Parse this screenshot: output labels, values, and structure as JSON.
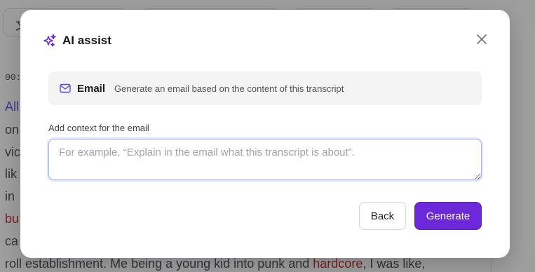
{
  "background": {
    "toolbar_glyph": "文",
    "timestamp": "00:",
    "lines": [
      {
        "text": "All"
      },
      {
        "text": "on"
      },
      {
        "text": "vic"
      },
      {
        "text": "lik"
      },
      {
        "text": "in"
      },
      {
        "text": "bu"
      },
      {
        "text": "ca"
      },
      {
        "before": "roll establishment. Me being a young kid into punk and ",
        "highlight": "hardcore",
        "after": ", I was like,"
      }
    ]
  },
  "modal": {
    "title": "AI assist",
    "icon": "sparkle-icon",
    "close_icon": "close-icon",
    "accent_color": "#6d28d9",
    "option": {
      "icon": "mail-icon",
      "title": "Email",
      "description": "Generate an email based on the content of this transcript"
    },
    "field_label": "Add context for the email",
    "input": {
      "value": "",
      "placeholder": "For example, “Explain in the email what this transcript is about”."
    },
    "buttons": {
      "back": "Back",
      "generate": "Generate"
    }
  }
}
